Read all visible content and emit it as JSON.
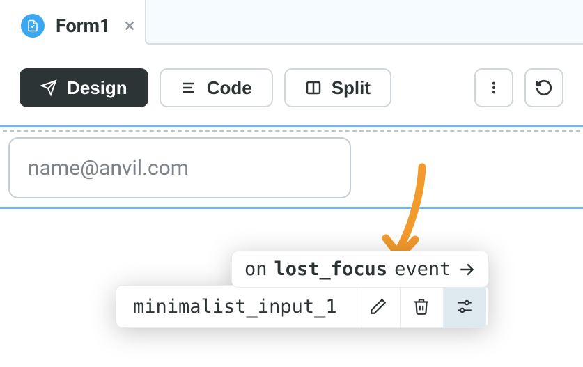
{
  "tab": {
    "label": "Form1"
  },
  "toolbar": {
    "design": "Design",
    "code": "Code",
    "split": "Split"
  },
  "input": {
    "placeholder": "name@anvil.com"
  },
  "popover": {
    "prefix": "on",
    "event": "lost_focus",
    "suffix": "event",
    "component_name": "minimalist_input_1"
  }
}
